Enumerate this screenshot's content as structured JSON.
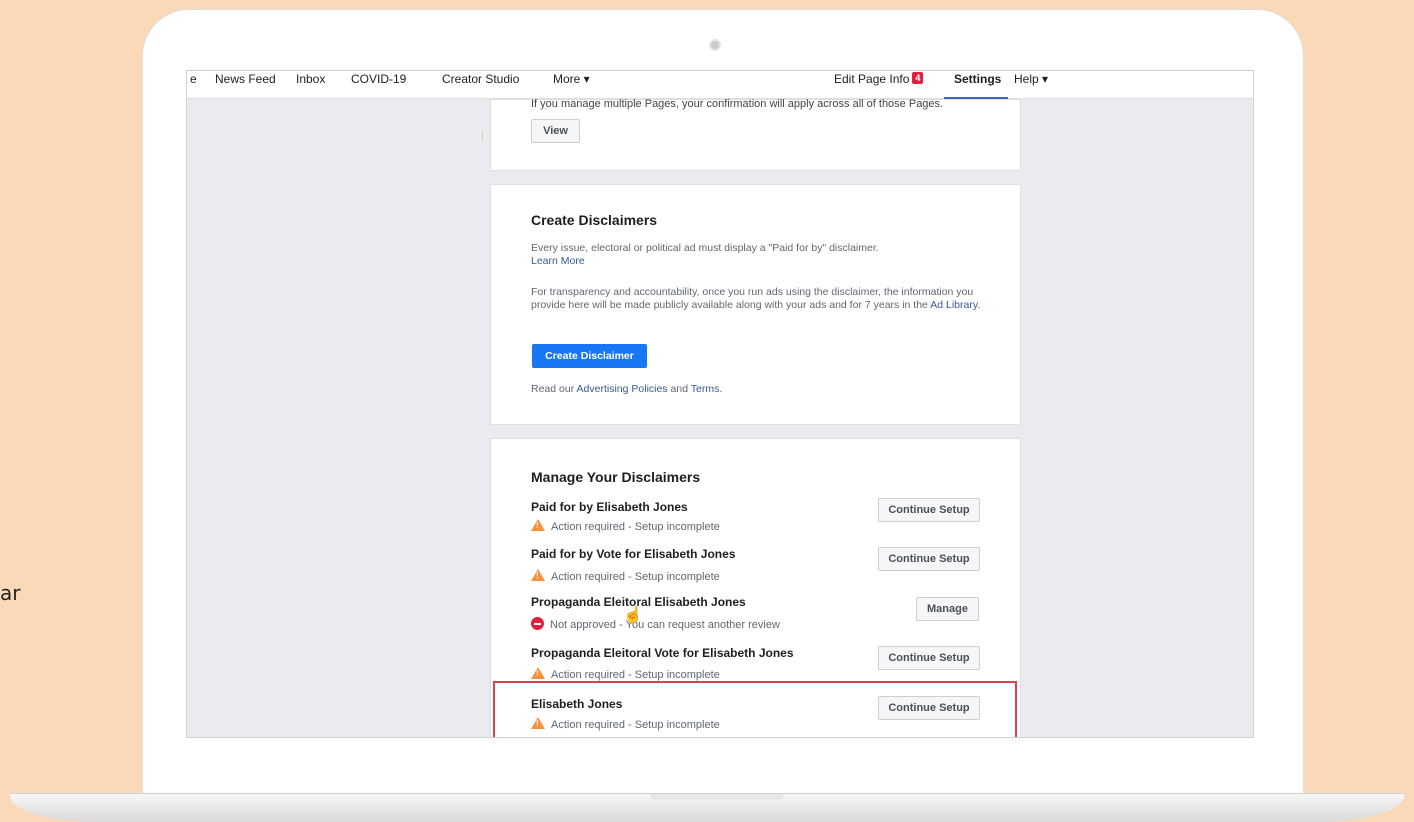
{
  "side_text": "ar",
  "topbar": {
    "nav_items": [
      "e",
      "News Feed",
      "Inbox",
      "COVID-19",
      "Creator Studio",
      "More ▾"
    ],
    "edit_page_info": "Edit Page Info",
    "badge_count": "4",
    "settings": "Settings",
    "help": "Help ▾"
  },
  "card1": {
    "partial_text": "If you manage multiple Pages, your confirmation will apply across all of those Pages.",
    "view_button": "View"
  },
  "create_disclaimers": {
    "title": "Create Disclaimers",
    "para1": "Every issue, electoral or political ad must display a \"Paid for by\" disclaimer.",
    "learn_more": "Learn More",
    "para2": "For transparency and accountability, once you run ads using the disclaimer, the information you provide here will be made publicly available along with your ads and for 7 years in the",
    "ad_library": "Ad Library",
    "para2_end": ".",
    "button": "Create Disclaimer",
    "footer_prefix": "Read our",
    "policies_link": "Advertising Policies",
    "and": "and",
    "terms_link": "Terms",
    "footer_end": "."
  },
  "manage_disclaimers": {
    "title": "Manage Your Disclaimers",
    "rows": [
      {
        "name": "Paid for by Elisabeth Jones",
        "status": "Action required - Setup incomplete",
        "action": "Continue Setup",
        "status_type": "warning"
      },
      {
        "name": "Paid for by Vote for Elisabeth Jones",
        "status": "Action required - Setup incomplete",
        "action": "Continue Setup",
        "status_type": "warning"
      },
      {
        "name": "Propaganda Eleitoral Elisabeth Jones",
        "status": "Not approved - You can request another review",
        "action": "Manage",
        "status_type": "error"
      },
      {
        "name": "Propaganda Eleitoral Vote for Elisabeth Jones",
        "status": "Action required - Setup incomplete",
        "action": "Continue Setup",
        "status_type": "warning"
      },
      {
        "name": "Elisabeth Jones",
        "status": "Action required - Setup incomplete",
        "action": "Continue Setup",
        "status_type": "warning"
      }
    ]
  },
  "colors": {
    "background": "#fad9b9",
    "primary_button": "#1877f2",
    "link": "#385898",
    "highlight_border": "#d9434f",
    "warning": "#f7923a",
    "error": "#e41e3f"
  }
}
